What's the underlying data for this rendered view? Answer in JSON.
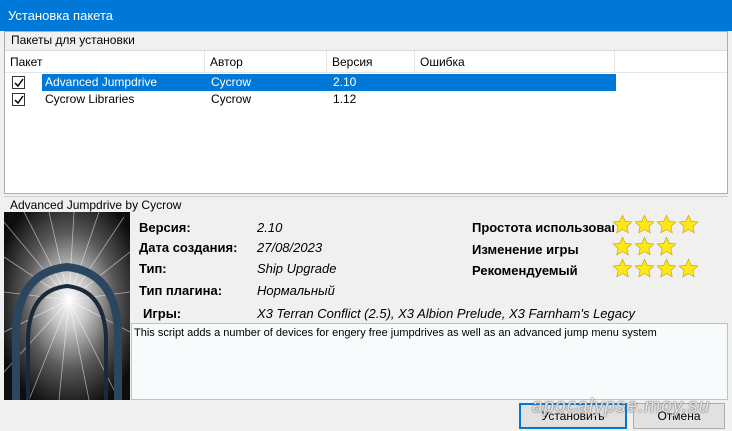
{
  "window": {
    "title": "Установка пакета"
  },
  "packages": {
    "group_title": "Пакеты для установки",
    "columns": [
      "Пакет",
      "Автор",
      "Версия",
      "Ошибка"
    ],
    "rows": [
      {
        "checked": true,
        "name": "Advanced Jumpdrive",
        "author": "Cycrow",
        "version": "2.10",
        "error": "",
        "selected": true
      },
      {
        "checked": true,
        "name": "Cycrow Libraries",
        "author": "Cycrow",
        "version": "1.12",
        "error": "",
        "selected": false
      }
    ]
  },
  "details": {
    "group_title": "Advanced Jumpdrive by Cycrow",
    "version_label": "Версия:",
    "version_value": "2.10",
    "created_label": "Дата создания:",
    "created_value": "27/08/2023",
    "type_label": "Тип:",
    "type_value": "Ship Upgrade",
    "plugin_label": "Тип плагина:",
    "plugin_value": "Нормальный",
    "games_label": "Игры:",
    "games_value": "X3 Terran Conflict (2.5), X3 Albion Prelude, X3 Farnham's Legacy",
    "ratings": [
      {
        "label": "Простота использования",
        "stars": 4
      },
      {
        "label": "Изменение игры",
        "stars": 3
      },
      {
        "label": "Рекомендуемый",
        "stars": 4
      }
    ],
    "description": "This script adds a number of devices for engery free jumpdrives as well as an advanced jump menu system"
  },
  "buttons": {
    "install": "Установить",
    "cancel": "Отмена"
  },
  "watermark": "apocalypse.moy.su",
  "colors": {
    "accent": "#0078d7",
    "star": "#ffe81a",
    "desc_border": "#9ccfe6"
  }
}
